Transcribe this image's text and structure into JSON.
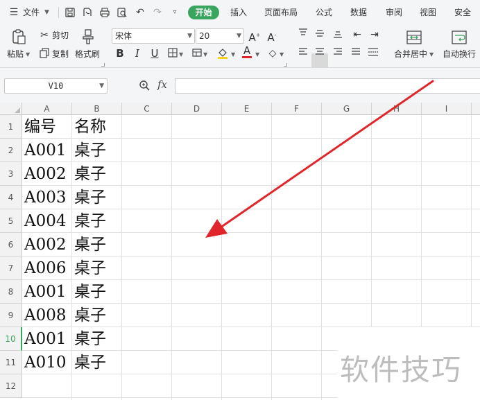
{
  "menu": {
    "file_label": "文件",
    "tabs": [
      "开始",
      "插入",
      "页面布局",
      "公式",
      "数据",
      "审阅",
      "视图",
      "安全"
    ]
  },
  "ribbon": {
    "paste": "粘贴",
    "cut": "剪切",
    "copy": "复制",
    "format_painter": "格式刷",
    "font_name": "宋体",
    "font_size": "20",
    "merge_center": "合并居中",
    "wrap_text": "自动换行"
  },
  "formula_bar": {
    "name_box": "V10",
    "fx": "fx",
    "formula": ""
  },
  "sheet": {
    "columns": [
      "A",
      "B",
      "C",
      "D",
      "E",
      "F",
      "G",
      "H",
      "I"
    ],
    "rows": [
      "1",
      "2",
      "3",
      "4",
      "5",
      "6",
      "7",
      "8",
      "9",
      "10",
      "11",
      "12"
    ],
    "selected_row": "10",
    "cells": [
      [
        "编号",
        "名称"
      ],
      [
        "A001",
        "桌子"
      ],
      [
        "A002",
        "桌子"
      ],
      [
        "A003",
        "桌子"
      ],
      [
        "A004",
        "桌子"
      ],
      [
        "A002",
        "桌子"
      ],
      [
        "A006",
        "桌子"
      ],
      [
        "A001",
        "桌子"
      ],
      [
        "A008",
        "桌子"
      ],
      [
        "A001",
        "桌子"
      ],
      [
        "A010",
        "桌子"
      ]
    ]
  },
  "watermark": "软件技巧",
  "colors": {
    "accent": "#3aa55e",
    "arrow": "#e0262b"
  }
}
